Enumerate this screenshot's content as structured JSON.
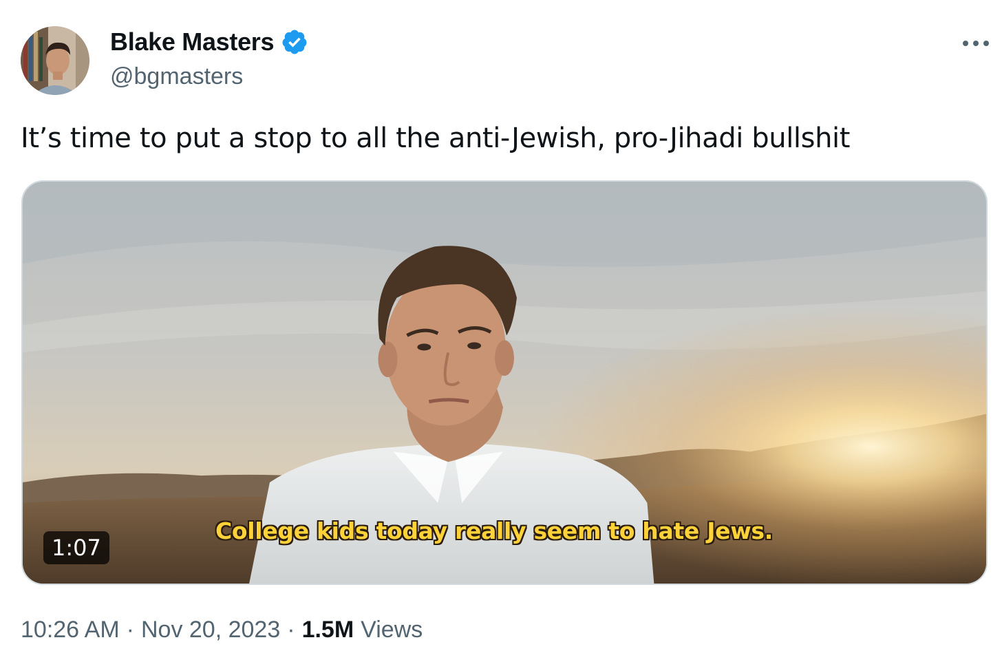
{
  "author": {
    "display_name": "Blake Masters",
    "handle": "@bgmasters",
    "verified": true,
    "verified_color": "#1d9bf0"
  },
  "more_icon": "more-horizontal-icon",
  "tweet": {
    "text": "It’s time to put a stop to all the anti-Jewish, pro-Jihadi bullshit"
  },
  "video": {
    "subtitle": "College kids today really seem to hate Jews.",
    "duration": "1:07"
  },
  "meta": {
    "time": "10:26 AM",
    "separator": "·",
    "date": "Nov 20, 2023",
    "views_count": "1.5M",
    "views_label": "Views"
  },
  "colors": {
    "primary_text": "#0f1419",
    "secondary_text": "#536471",
    "subtitle": "#ffd23a"
  }
}
